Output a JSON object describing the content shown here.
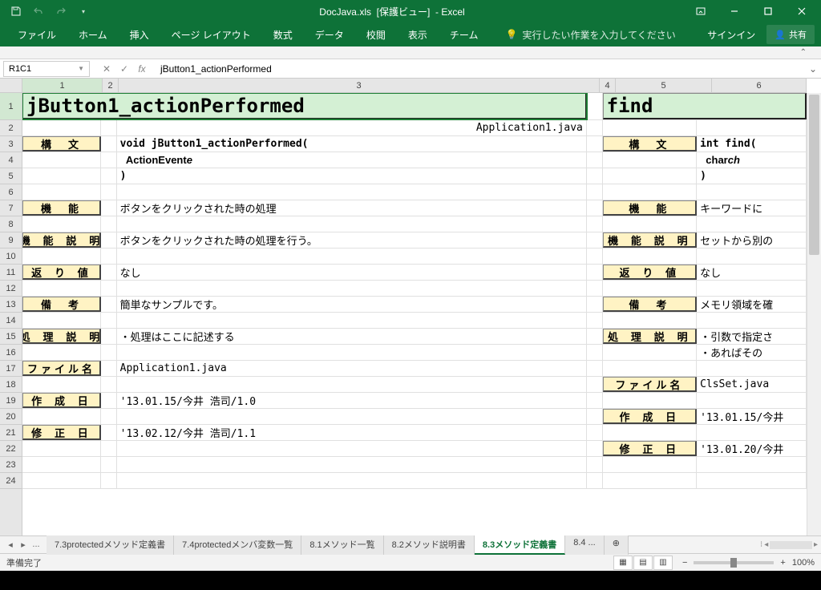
{
  "titlebar": {
    "doc_name": "DocJava.xls",
    "view_mode": "[保護ビュー]",
    "app_name": "- Excel"
  },
  "ribbon": {
    "tabs": [
      "ファイル",
      "ホーム",
      "挿入",
      "ページ レイアウト",
      "数式",
      "データ",
      "校閲",
      "表示",
      "チーム"
    ],
    "tell_me": "実行したい作業を入力してください",
    "signin": "サインイン",
    "share": "共有"
  },
  "formula": {
    "name_box": "R1C1",
    "value": "jButton1_actionPerformed"
  },
  "columns": [
    "1",
    "2",
    "3",
    "4",
    "5",
    "6"
  ],
  "rows_visible": 24,
  "sheet1": {
    "title": "jButton1_actionPerformed",
    "file_origin": "Application1.java",
    "labels": {
      "syntax": "構　文",
      "function": "機　能",
      "desc": "機 能 説 明",
      "return": "返 り 値",
      "remarks": "備　考",
      "proc": "処 理 説 明",
      "filename": "ファイル名",
      "created": "作 成 日",
      "modified": "修 正 日"
    },
    "values": {
      "syntax1": "void jButton1_actionPerformed(",
      "syntax2": "  ActionEvent e",
      "syntax3": ")",
      "function": "ボタンをクリックされた時の処理",
      "desc": "ボタンをクリックされた時の処理を行う。",
      "return": "なし",
      "remarks": "簡単なサンプルです。",
      "proc": "・処理はここに記述する",
      "filename": "Application1.java",
      "created": "'13.01.15/今井 浩司/1.0",
      "modified": "'13.02.12/今井 浩司/1.1"
    }
  },
  "sheet2": {
    "title": "find",
    "values": {
      "syntax1": "int find(",
      "syntax2": "  char ch",
      "syntax3": ")",
      "function": "キーワードに",
      "desc": "セットから別の",
      "return": "なし",
      "remarks": "メモリ領域を確",
      "proc1": "・引数で指定さ",
      "proc2": "・あればその",
      "filename": "ClsSet.java",
      "created": "'13.01.15/今井",
      "modified": "'13.01.20/今井"
    }
  },
  "tabs": {
    "items": [
      "7.3protectedメソッド定義書",
      "7.4protectedメンバ変数一覧",
      "8.1メソッド一覧",
      "8.2メソッド説明書",
      "8.3メソッド定義書",
      "8.4 ..."
    ],
    "active": 4,
    "more": "..."
  },
  "status": {
    "ready": "準備完了",
    "zoom": "100%"
  }
}
